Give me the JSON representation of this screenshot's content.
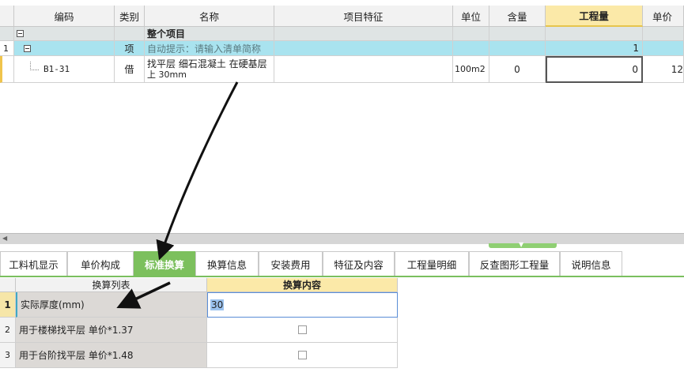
{
  "columns": {
    "code": "编码",
    "category": "类别",
    "name": "名称",
    "feature": "项目特征",
    "unit": "单位",
    "content": "含量",
    "quantity": "工程量",
    "price": "单价"
  },
  "rows": {
    "root": {
      "name": "整个项目"
    },
    "item": {
      "index": "1",
      "category": "项",
      "name_hint": "自动提示：请输入清单简称",
      "quantity": "1"
    },
    "sub": {
      "code": "B1-31",
      "category": "借",
      "name_line1": "找平层 细石混凝土 在硬基层",
      "name_line2": "上 30mm",
      "unit": "100m2",
      "content": "0",
      "quantity": "0",
      "price": "12"
    }
  },
  "tabs": [
    "工料机显示",
    "单价构成",
    "标准换算",
    "换算信息",
    "安装费用",
    "特征及内容",
    "工程量明细",
    "反查图形工程量",
    "说明信息"
  ],
  "active_tab": "标准换算",
  "conversion": {
    "col_list": "换算列表",
    "col_content": "换算内容",
    "rows": [
      {
        "index": "1",
        "label": "实际厚度(mm)",
        "value": "30"
      },
      {
        "index": "2",
        "label": "用于楼梯找平层 单价*1.37",
        "checked": false
      },
      {
        "index": "3",
        "label": "用于台阶找平层 单价*1.48",
        "checked": false
      }
    ]
  },
  "colors": {
    "active_tab": "#7cc05d",
    "highlight_row": "#a9e3ef",
    "active_header": "#fbe9a8"
  }
}
